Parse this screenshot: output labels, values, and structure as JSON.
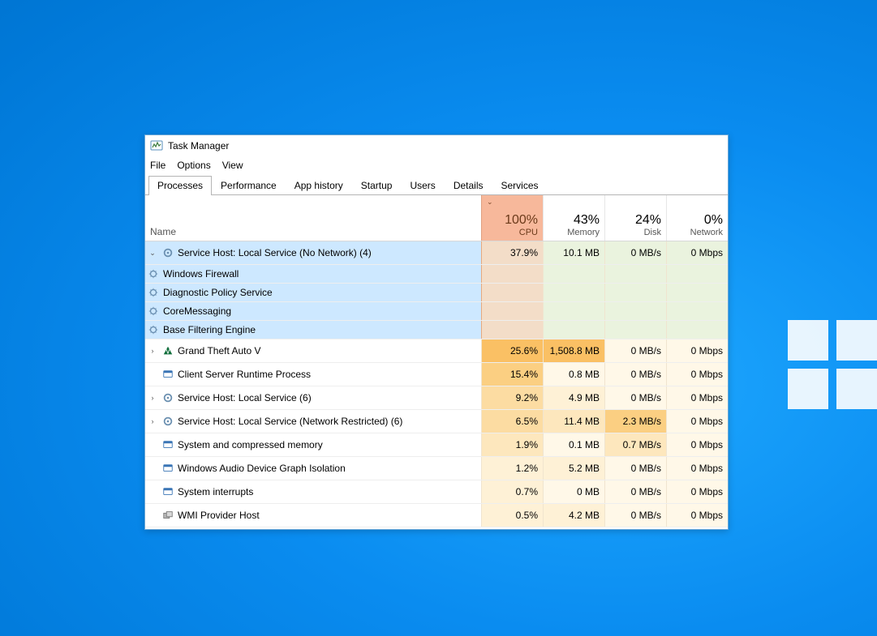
{
  "window": {
    "title": "Task Manager"
  },
  "menu": {
    "file": "File",
    "options": "Options",
    "view": "View"
  },
  "tabs": {
    "processes": "Processes",
    "performance": "Performance",
    "apphistory": "App history",
    "startup": "Startup",
    "users": "Users",
    "details": "Details",
    "services": "Services"
  },
  "columns": {
    "name": "Name",
    "cpu": {
      "pct": "100%",
      "label": "CPU"
    },
    "memory": {
      "pct": "43%",
      "label": "Memory"
    },
    "disk": {
      "pct": "24%",
      "label": "Disk"
    },
    "network": {
      "pct": "0%",
      "label": "Network"
    }
  },
  "selected": {
    "name": "Service Host: Local Service (No Network) (4)",
    "cpu": "37.9%",
    "memory": "10.1 MB",
    "disk": "0 MB/s",
    "network": "0 Mbps",
    "children": [
      "Windows Firewall",
      "Diagnostic Policy Service",
      "CoreMessaging",
      "Base Filtering Engine"
    ]
  },
  "rows": [
    {
      "icon": "gtav",
      "expand": "›",
      "name": "Grand Theft Auto V",
      "cpu": "25.6%",
      "mem": "1,508.8 MB",
      "disk": "0 MB/s",
      "net": "0 Mbps",
      "ch": 5,
      "mh": 5
    },
    {
      "icon": "winproc",
      "expand": "",
      "name": "Client Server Runtime Process",
      "cpu": "15.4%",
      "mem": "0.8 MB",
      "disk": "0 MB/s",
      "net": "0 Mbps",
      "ch": 4,
      "mh": 0
    },
    {
      "icon": "gear",
      "expand": "›",
      "name": "Service Host: Local Service (6)",
      "cpu": "9.2%",
      "mem": "4.9 MB",
      "disk": "0 MB/s",
      "net": "0 Mbps",
      "ch": 3,
      "mh": 1
    },
    {
      "icon": "gear",
      "expand": "›",
      "name": "Service Host: Local Service (Network Restricted) (6)",
      "cpu": "6.5%",
      "mem": "11.4 MB",
      "disk": "2.3 MB/s",
      "net": "0 Mbps",
      "ch": 3,
      "mh": 2,
      "dh": 4
    },
    {
      "icon": "winproc",
      "expand": "",
      "name": "System and compressed memory",
      "cpu": "1.9%",
      "mem": "0.1 MB",
      "disk": "0.7 MB/s",
      "net": "0 Mbps",
      "ch": 2,
      "mh": 0,
      "dh": 2
    },
    {
      "icon": "winproc",
      "expand": "",
      "name": "Windows Audio Device Graph Isolation",
      "cpu": "1.2%",
      "mem": "5.2 MB",
      "disk": "0 MB/s",
      "net": "0 Mbps",
      "ch": 1,
      "mh": 1
    },
    {
      "icon": "winproc",
      "expand": "",
      "name": "System interrupts",
      "cpu": "0.7%",
      "mem": "0 MB",
      "disk": "0 MB/s",
      "net": "0 Mbps",
      "ch": 1,
      "mh": 0
    },
    {
      "icon": "wmi",
      "expand": "",
      "name": "WMI Provider Host",
      "cpu": "0.5%",
      "mem": "4.2 MB",
      "disk": "0 MB/s",
      "net": "0 Mbps",
      "ch": 1,
      "mh": 1
    }
  ]
}
